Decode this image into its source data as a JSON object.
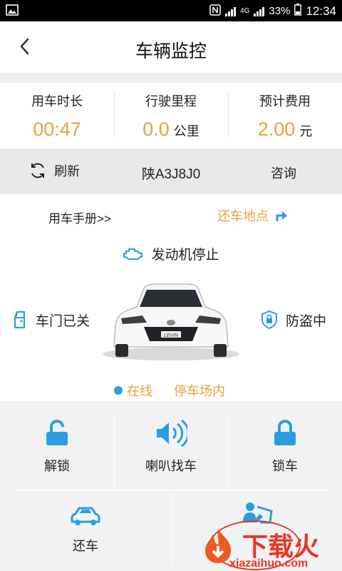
{
  "status_bar": {
    "signal_label": "4G",
    "battery": "33%",
    "time": "12:34"
  },
  "header": {
    "title": "车辆监控"
  },
  "stats": [
    {
      "label": "用车时长",
      "value": "00:47",
      "unit": ""
    },
    {
      "label": "行驶里程",
      "value": "0.0",
      "unit": "公里"
    },
    {
      "label": "预计费用",
      "value": "2.00",
      "unit": "元"
    }
  ],
  "toolbar": {
    "refresh_label": "刷新",
    "plate": "陕A3J8J0",
    "consult_label": "咨询"
  },
  "vehicle": {
    "manual_link": "用车手册>>",
    "return_spot": "还车地点",
    "engine_status": "发动机停止",
    "door_status": "车门已关",
    "guard_status": "防盗中",
    "online_status": "在线",
    "parking_status": "停车场内",
    "car_badge": "LEVIN"
  },
  "actions": [
    {
      "label": "解锁",
      "icon": "unlock-icon"
    },
    {
      "label": "喇叭找车",
      "icon": "speaker-icon"
    },
    {
      "label": "锁车",
      "icon": "lock-icon"
    },
    {
      "label": "还车",
      "icon": "car-icon"
    }
  ],
  "watermark": {
    "cn": "下载火",
    "en": "xiazaihuo.com"
  },
  "colors": {
    "accent": "#e6a23c",
    "icon_blue": "#2a9ee0"
  }
}
